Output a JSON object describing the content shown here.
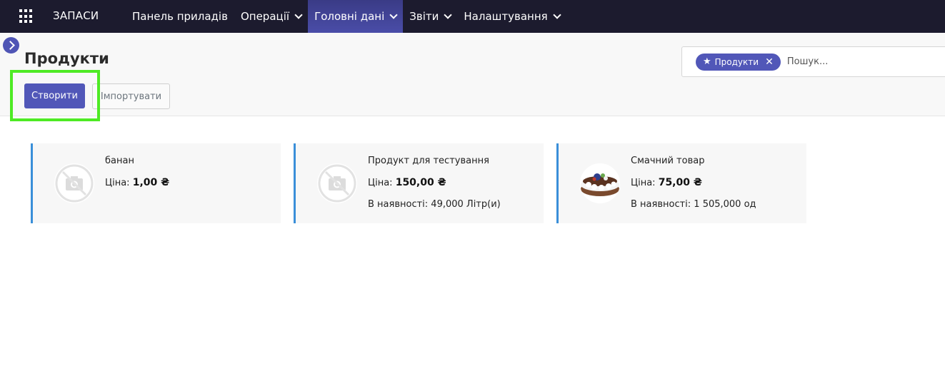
{
  "navbar": {
    "brand": "ЗАПАСИ",
    "menu": [
      {
        "label": "Панель приладів",
        "dropdown": false
      },
      {
        "label": "Операції",
        "dropdown": true
      },
      {
        "label": "Головні дані",
        "dropdown": true,
        "active": true
      },
      {
        "label": "Звіти",
        "dropdown": true
      },
      {
        "label": "Налаштування",
        "dropdown": true
      }
    ]
  },
  "control_panel": {
    "title": "Продукти",
    "create_label": "Створити",
    "import_label": "Імпортувати",
    "search": {
      "facet_label": "Продукти",
      "facet_icon": "star-icon",
      "placeholder": "Пошук..."
    }
  },
  "products": [
    {
      "name": "банан",
      "price_label": "Ціна:",
      "price": "1,00 ₴",
      "stock": "",
      "image": "no-photo-icon"
    },
    {
      "name": "Продукт для тестування",
      "price_label": "Ціна:",
      "price": "150,00 ₴",
      "stock": "В наявності: 49,000 Літр(и)",
      "image": "no-photo-icon"
    },
    {
      "name": "Смачний товар",
      "price_label": "Ціна:",
      "price": "75,00 ₴",
      "stock": "В наявності: 1 505,000 од",
      "image": "cake-photo"
    }
  ],
  "colors": {
    "navbar_bg": "#1c1b2e",
    "primary": "#5157b8",
    "highlight": "#4eea24",
    "card_border": "#3a8fd9"
  }
}
